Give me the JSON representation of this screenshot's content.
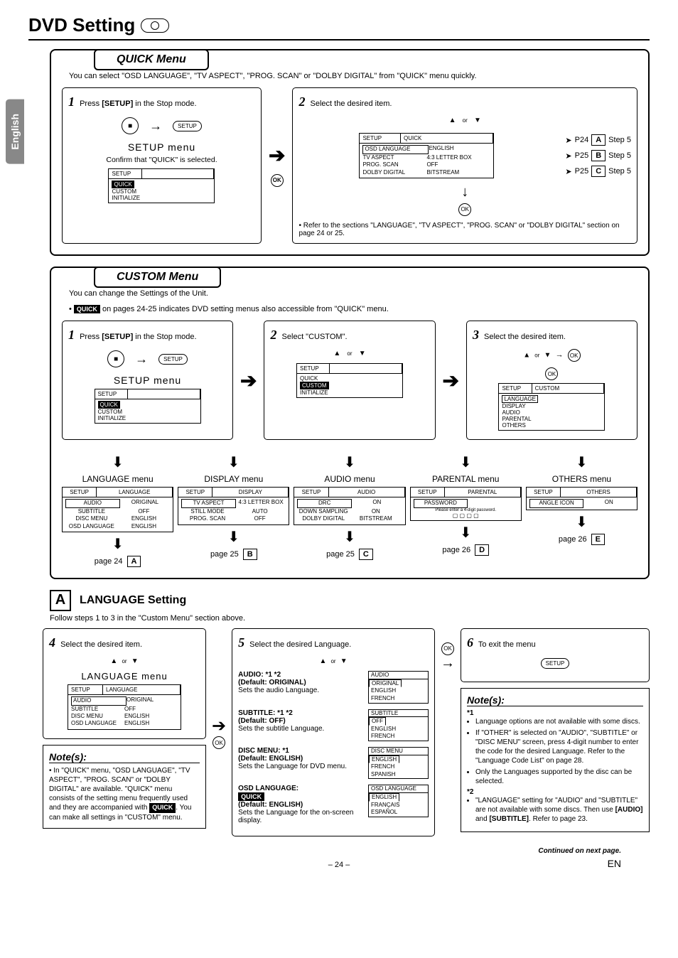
{
  "lang_tab": "English",
  "page_title": "DVD Setting",
  "quick": {
    "tab": "QUICK Menu",
    "intro": "You can select \"OSD LANGUAGE\", \"TV ASPECT\", \"PROG. SCAN\" or \"DOLBY DIGITAL\" from \"QUICK\" menu quickly.",
    "step1_num": "1",
    "step1_a": "Press ",
    "step1_b": "[SETUP]",
    "step1_c": " in the Stop mode.",
    "setup_title": "SETUP menu",
    "confirm": "Confirm that \"QUICK\" is selected.",
    "osd_setup_label": "SETUP",
    "osd_items": [
      "QUICK",
      "CUSTOM",
      "INITIALIZE"
    ],
    "step2_num": "2",
    "step2_text": "Select the desired item.",
    "nav_or": "or",
    "osd2_head_a": "SETUP",
    "osd2_head_b": "QUICK",
    "osd2_rows": [
      [
        "OSD LANGUAGE",
        "ENGLISH"
      ],
      [
        "TV ASPECT",
        "4:3 LETTER BOX"
      ],
      [
        "PROG. SCAN",
        "OFF"
      ],
      [
        "DOLBY DIGITAL",
        "BITSTREAM"
      ]
    ],
    "ref_a": [
      "P24",
      "A",
      "Step 5"
    ],
    "ref_b": [
      "P25",
      "B",
      "Step 5"
    ],
    "ref_c": [
      "P25",
      "C",
      "Step 5"
    ],
    "note": "• Refer to the sections \"LANGUAGE\", \"TV ASPECT\", \"PROG. SCAN\" or \"DOLBY DIGITAL\" section on page 24 or 25."
  },
  "custom": {
    "tab": "CUSTOM Menu",
    "intro1": "You can change the Settings of the Unit.",
    "intro2_a": "• ",
    "intro2_badge": "QUICK",
    "intro2_b": " on pages 24-25 indicates DVD setting menus also accessible from \"QUICK\" menu.",
    "step1_num": "1",
    "step1_a": "Press ",
    "step1_b": "[SETUP]",
    "step1_c": " in the Stop mode.",
    "setup_title": "SETUP menu",
    "step2_num": "2",
    "step2_text": "Select \"CUSTOM\".",
    "step3_num": "3",
    "step3_text": "Select the desired item.",
    "osd3_head_a": "SETUP",
    "osd3_head_b": "CUSTOM",
    "osd3_items": [
      "LANGUAGE",
      "DISPLAY",
      "AUDIO",
      "PARENTAL",
      "OTHERS"
    ],
    "menus": [
      {
        "title": "LANGUAGE menu",
        "head": [
          "SETUP",
          "LANGUAGE"
        ],
        "rows": [
          [
            "AUDIO",
            "ORIGINAL"
          ],
          [
            "SUBTITLE",
            "OFF"
          ],
          [
            "DISC MENU",
            "ENGLISH"
          ],
          [
            "OSD LANGUAGE",
            "ENGLISH"
          ]
        ],
        "page": "page 24",
        "letter": "A"
      },
      {
        "title": "DISPLAY menu",
        "head": [
          "SETUP",
          "DISPLAY"
        ],
        "rows": [
          [
            "TV ASPECT",
            "4:3 LETTER BOX"
          ],
          [
            "STILL MODE",
            "AUTO"
          ],
          [
            "PROG. SCAN",
            "OFF"
          ]
        ],
        "page": "page 25",
        "letter": "B"
      },
      {
        "title": "AUDIO menu",
        "head": [
          "SETUP",
          "AUDIO"
        ],
        "rows": [
          [
            "DRC",
            "ON"
          ],
          [
            "DOWN SAMPLING",
            "ON"
          ],
          [
            "DOLBY DIGITAL",
            "BITSTREAM"
          ]
        ],
        "page": "page 25",
        "letter": "C"
      },
      {
        "title": "PARENTAL menu",
        "head": [
          "SETUP",
          "PARENTAL"
        ],
        "rows": [
          [
            "PASSWORD",
            ""
          ]
        ],
        "hint": "Please enter a 4-digit password.",
        "page": "page 26",
        "letter": "D"
      },
      {
        "title": "OTHERS menu",
        "head": [
          "SETUP",
          "OTHERS"
        ],
        "rows": [
          [
            "ANGLE ICON",
            "ON"
          ]
        ],
        "page": "page 26",
        "letter": "E"
      }
    ]
  },
  "langSetting": {
    "letter": "A",
    "title": "LANGUAGE Setting",
    "follow": "Follow steps 1 to 3 in the \"Custom Menu\" section above.",
    "step4_num": "4",
    "step4_text": "Select the desired item.",
    "menu_title": "LANGUAGE menu",
    "osd_head": [
      "SETUP",
      "LANGUAGE"
    ],
    "osd_rows": [
      [
        "AUDIO",
        "ORIGINAL"
      ],
      [
        "SUBTITLE",
        "OFF"
      ],
      [
        "DISC MENU",
        "ENGLISH"
      ],
      [
        "OSD LANGUAGE",
        "ENGLISH"
      ]
    ],
    "notes1_title": "Note(s):",
    "notes1_body_a": "• In \"QUICK\" menu, \"OSD LANGUAGE\", \"TV ASPECT\", \"PROG. SCAN\" or \"DOLBY DIGITAL\" are available. \"QUICK\" menu consists of the setting menu frequently used and they are accompanied with ",
    "notes1_badge": "QUICK",
    "notes1_body_b": ". You can make all settings in \"CUSTOM\" menu.",
    "step5_num": "5",
    "step5_text": "Select the desired Language.",
    "settings": [
      {
        "label": "AUDIO: *1 *2",
        "default": "(Default: ORIGINAL)",
        "desc": "Sets the audio Language.",
        "opts": [
          "AUDIO",
          "ORIGINAL",
          "ENGLISH",
          "FRENCH"
        ]
      },
      {
        "label": "SUBTITLE: *1 *2",
        "default": "(Default: OFF)",
        "desc": "Sets the subtitle Language.",
        "opts": [
          "SUBTITLE",
          "OFF",
          "ENGLISH",
          "FRENCH"
        ]
      },
      {
        "label": "DISC MENU: *1",
        "default": "(Default: ENGLISH)",
        "desc": "Sets the Language for DVD menu.",
        "opts": [
          "DISC MENU",
          "ENGLISH",
          "FRENCH",
          "SPANISH"
        ]
      },
      {
        "label": "OSD LANGUAGE:",
        "badge": "QUICK",
        "default": "(Default: ENGLISH)",
        "desc": "Sets the Language for the on-screen display.",
        "opts": [
          "OSD LANGUAGE",
          "ENGLISH",
          "FRANÇAIS",
          "ESPAÑOL"
        ]
      }
    ],
    "step6_num": "6",
    "step6_text": "To exit the menu",
    "notes2_title": "Note(s):",
    "n2_star1": "*1",
    "n2_items1": [
      "Language options are not available with some discs.",
      "If \"OTHER\" is selected on \"AUDIO\", \"SUBTITLE\" or \"DISC MENU\" screen, press 4-digit number to enter the code for the desired Language. Refer to the \"Language Code List\" on page 28.",
      "Only the Languages supported by the disc can be selected."
    ],
    "n2_star2": "*2",
    "n2_item2_a": "\"LANGUAGE\" setting for \"AUDIO\" and \"SUBTITLE\" are not available with some discs. Then use ",
    "n2_item2_b": "[AUDIO]",
    "n2_item2_c": " and ",
    "n2_item2_d": "[SUBTITLE]",
    "n2_item2_e": ". Refer to page 23."
  },
  "footer": {
    "continued": "Continued on next page.",
    "page": "– 24 –",
    "en": "EN"
  },
  "icons": {
    "stop": "■",
    "setup": "SETUP",
    "ok": "OK",
    "up": "▲",
    "down": "▼",
    "right": "→"
  }
}
